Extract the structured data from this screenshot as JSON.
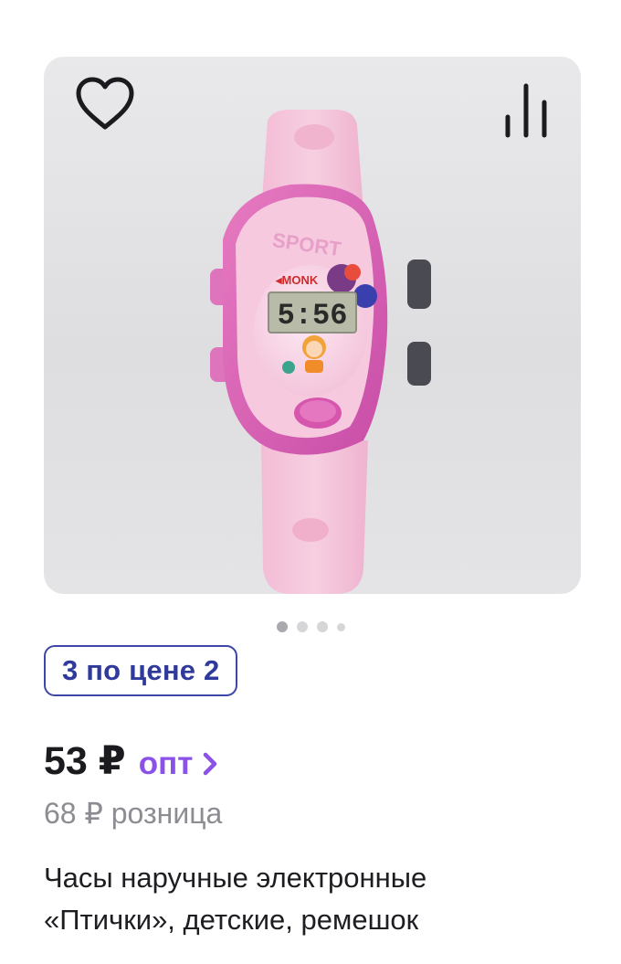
{
  "product": {
    "promo_badge": "3 по цене 2",
    "price": {
      "wholesale_value": "53",
      "currency": "₽",
      "wholesale_label": "опт",
      "retail_value": "68",
      "retail_label": "розница"
    },
    "title_line1": "Часы наручные электронные",
    "title_line2": "«Птички», детские, ремешок",
    "watch_print": {
      "brand": "SPORT",
      "display_time": "5:56",
      "sticker_text": "◂MONK"
    }
  },
  "gallery": {
    "image_count": 4,
    "active_index": 0
  },
  "colors": {
    "promo_border": "#3d47a8",
    "wholesale_accent": "#8a52e8",
    "price_text": "#1b1b1f",
    "muted_text": "#8c8c92"
  },
  "icons": {
    "favorite": "heart-outline-icon",
    "compare": "bar-chart-icon",
    "wholesale_arrow": "chevron-right-icon"
  }
}
